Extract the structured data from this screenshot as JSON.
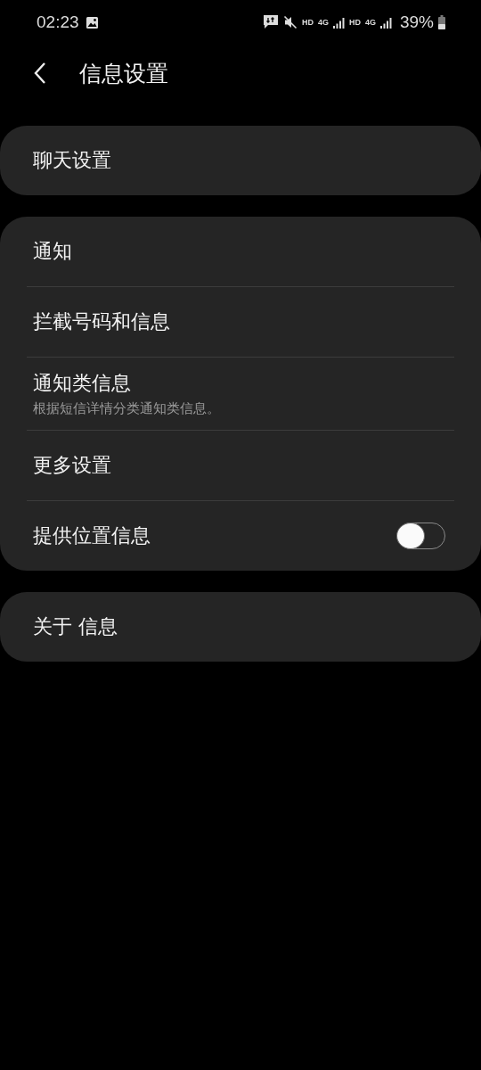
{
  "status_bar": {
    "time": "02:23",
    "network": [
      {
        "label": "HD"
      },
      {
        "label": "4G"
      },
      {
        "label": "HD"
      },
      {
        "label": "4G"
      }
    ],
    "battery": "39%"
  },
  "header": {
    "title": "信息设置"
  },
  "groups": [
    {
      "items": [
        {
          "kind": "link",
          "title": "聊天设置"
        }
      ]
    },
    {
      "items": [
        {
          "kind": "link",
          "title": "通知"
        },
        {
          "kind": "link",
          "title": "拦截号码和信息"
        },
        {
          "kind": "link",
          "title": "通知类信息",
          "subtitle": "根据短信详情分类通知类信息。"
        },
        {
          "kind": "link",
          "title": "更多设置"
        },
        {
          "kind": "toggle",
          "title": "提供位置信息",
          "on": false
        }
      ]
    },
    {
      "items": [
        {
          "kind": "link",
          "title": "关于 信息"
        }
      ]
    }
  ]
}
